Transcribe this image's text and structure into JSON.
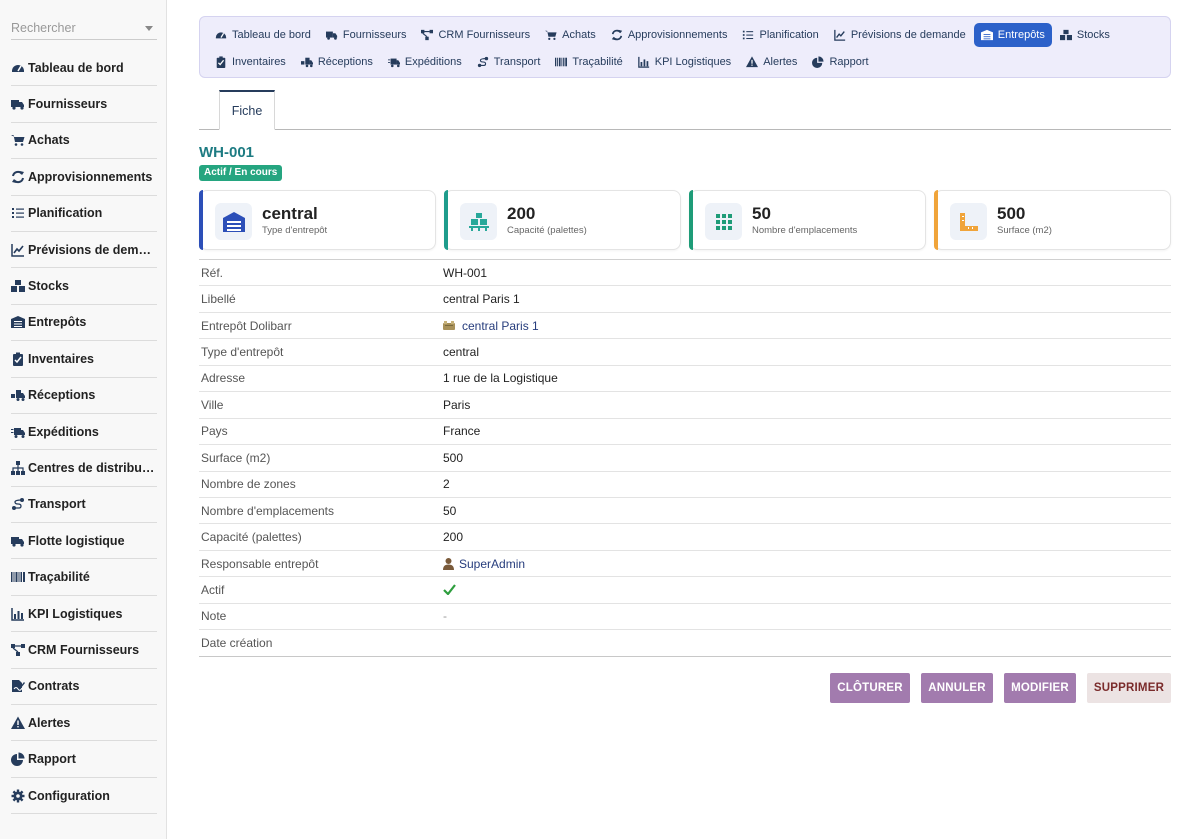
{
  "search": {
    "placeholder": "Rechercher"
  },
  "sidebar": {
    "items": [
      {
        "label": "Tableau de bord",
        "icon": "dashboard-icon"
      },
      {
        "label": "Fournisseurs",
        "icon": "truck-icon"
      },
      {
        "label": "Achats",
        "icon": "cart-icon"
      },
      {
        "label": "Approvisionnements",
        "icon": "sync-icon"
      },
      {
        "label": "Planification",
        "icon": "tasks-icon"
      },
      {
        "label": "Prévisions de demande",
        "icon": "chart-line-icon"
      },
      {
        "label": "Stocks",
        "icon": "boxes-icon"
      },
      {
        "label": "Entrepôts",
        "icon": "warehouse-icon"
      },
      {
        "label": "Inventaires",
        "icon": "clipboard-check-icon"
      },
      {
        "label": "Réceptions",
        "icon": "truck-loading-icon"
      },
      {
        "label": "Expéditions",
        "icon": "shipping-fast-icon"
      },
      {
        "label": "Centres de distribution",
        "icon": "sitemap-icon"
      },
      {
        "label": "Transport",
        "icon": "route-icon"
      },
      {
        "label": "Flotte logistique",
        "icon": "truck-icon"
      },
      {
        "label": "Traçabilité",
        "icon": "barcode-icon"
      },
      {
        "label": "KPI Logistiques",
        "icon": "chart-bar-icon"
      },
      {
        "label": "CRM Fournisseurs",
        "icon": "project-diagram-icon"
      },
      {
        "label": "Contrats",
        "icon": "file-signature-icon"
      },
      {
        "label": "Alertes",
        "icon": "warning-icon"
      },
      {
        "label": "Rapport",
        "icon": "chart-pie-icon"
      },
      {
        "label": "Configuration",
        "icon": "gear-icon"
      }
    ]
  },
  "topmenu": {
    "row1": [
      {
        "label": "Tableau de bord",
        "icon": "dashboard-icon"
      },
      {
        "label": "Fournisseurs",
        "icon": "truck-icon"
      },
      {
        "label": "CRM Fournisseurs",
        "icon": "project-diagram-icon"
      },
      {
        "label": "Achats",
        "icon": "cart-icon"
      },
      {
        "label": "Approvisionnements",
        "icon": "sync-icon"
      },
      {
        "label": "Planification",
        "icon": "tasks-icon"
      },
      {
        "label": "Prévisions de demande",
        "icon": "chart-line-icon"
      },
      {
        "label": "Entrepôts",
        "icon": "warehouse-icon",
        "active": true
      },
      {
        "label": "Stocks",
        "icon": "boxes-icon"
      }
    ],
    "row2": [
      {
        "label": "Inventaires",
        "icon": "clipboard-check-icon"
      },
      {
        "label": "Réceptions",
        "icon": "truck-loading-icon"
      },
      {
        "label": "Expéditions",
        "icon": "shipping-fast-icon"
      },
      {
        "label": "Transport",
        "icon": "route-icon"
      },
      {
        "label": "Traçabilité",
        "icon": "barcode-icon"
      },
      {
        "label": "KPI Logistiques",
        "icon": "chart-bar-icon"
      },
      {
        "label": "Alertes",
        "icon": "warning-icon"
      },
      {
        "label": "Rapport",
        "icon": "chart-pie-icon"
      }
    ]
  },
  "tabs": {
    "fiche": "Fiche"
  },
  "record": {
    "ref": "WH-001",
    "status": "Actif / En cours"
  },
  "cards": [
    {
      "value": "central",
      "caption": "Type d'entrepôt",
      "icon": "warehouse-icon",
      "color": "#2c4fb8"
    },
    {
      "value": "200",
      "caption": "Capacité (palettes)",
      "icon": "pallet-boxes-icon",
      "color": "#1e9c8c"
    },
    {
      "value": "50",
      "caption": "Nombre d'emplacements",
      "icon": "grid-icon",
      "color": "#1e9c78"
    },
    {
      "value": "500",
      "caption": "Surface (m2)",
      "icon": "ruler-combined-icon",
      "color": "#f0a43a"
    }
  ],
  "fields": [
    {
      "label": "Réf.",
      "value": "WH-001"
    },
    {
      "label": "Libellé",
      "value": "central Paris 1"
    },
    {
      "label": "Entrepôt Dolibarr",
      "value": "central Paris 1"
    },
    {
      "label": "Type d'entrepôt",
      "value": "central"
    },
    {
      "label": "Adresse",
      "value": "1 rue de la Logistique"
    },
    {
      "label": "Ville",
      "value": "Paris"
    },
    {
      "label": "Pays",
      "value": "France"
    },
    {
      "label": "Surface (m2)",
      "value": "500"
    },
    {
      "label": "Nombre de zones",
      "value": "2"
    },
    {
      "label": "Nombre d'emplacements",
      "value": "50"
    },
    {
      "label": "Capacité (palettes)",
      "value": "200"
    },
    {
      "label": "Responsable entrepôt",
      "value": "SuperAdmin"
    },
    {
      "label": "Actif",
      "value": ""
    },
    {
      "label": "Note",
      "value": "-"
    },
    {
      "label": "Date création",
      "value": ""
    }
  ],
  "buttons": {
    "close": "CLÔTURER",
    "cancel": "ANNULER",
    "modify": "MODIFIER",
    "delete": "SUPPRIMER"
  },
  "colors": {
    "menu_active": "#2c61c9",
    "badge": "#25a580",
    "ref_title": "#1d7b82",
    "button_purple": "#a27bae",
    "check": "#2e9e3e"
  }
}
